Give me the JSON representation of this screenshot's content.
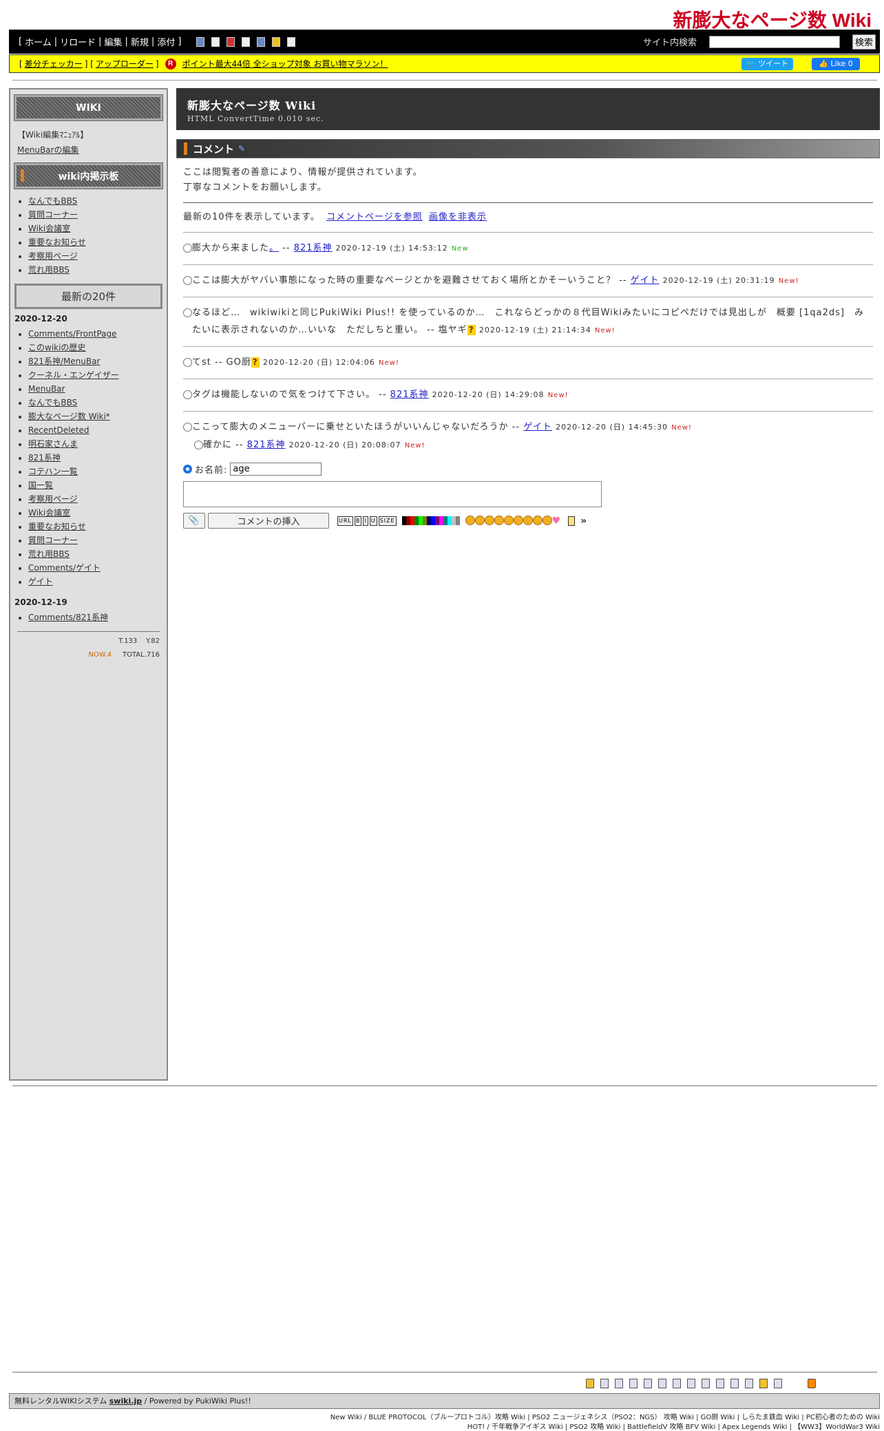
{
  "site_title": "新膨大なページ数 Wiki",
  "topnav": {
    "open_bracket": "[",
    "items": [
      "ホーム",
      "リロード",
      "編集",
      "新規",
      "添付"
    ],
    "separator": "|",
    "close_bracket": "]",
    "search_label": "サイト内検索",
    "search_button": "検索"
  },
  "yellowbar": {
    "diff_checker": "差分チェッカー",
    "uploader": "アップローダー",
    "promo": "ポイント最大44倍 全ショップ対象 お買い物マラソン！",
    "tweet": "ツイート",
    "like": "Like 0"
  },
  "sidebar": {
    "wiki_head": "WIKI",
    "manual_link": "【Wiki編集ﾏﾆｭｱﾙ】",
    "menubar_edit": "MenuBarの編集",
    "bbs_head": "wiki内掲示板",
    "bbs_items": [
      "なんでもBBS",
      "質問コーナー",
      "Wiki会議室",
      "重要なお知らせ",
      "考察用ページ",
      "荒れ用BBS"
    ],
    "recent_head": "最新の20件",
    "date1": "2020-12-20",
    "recent1": [
      "Comments/FrontPage",
      "このwikiの歴史",
      "821系神/MenuBar",
      "クーネル・エンゲイザー",
      "MenuBar",
      "なんでもBBS",
      "膨大なページ数 Wiki*",
      "RecentDeleted",
      "明石家さんま",
      "821系神",
      "コテハン一覧",
      "国一覧",
      "考察用ページ",
      "Wiki会議室",
      "重要なお知らせ",
      "質問コーナー",
      "荒れ用BBS",
      "Comments/ゲイト",
      "ゲイト"
    ],
    "date2": "2020-12-19",
    "recent2": [
      "Comments/821系神"
    ],
    "stat_t": "T.133",
    "stat_y": "Y.82",
    "stat_now": "NOW.4",
    "stat_total": "TOTAL.716"
  },
  "main": {
    "page_title": "新膨大なページ数 Wiki",
    "convert_time": "HTML ConvertTime 0.010 sec.",
    "section_title": "コメント",
    "intro1": "ここは閲覧者の善意により、情報が提供されています。",
    "intro2": "丁寧なコメントをお願いします。",
    "notice": "最新の10件を表示しています。",
    "see_comments": "コメントページを参照",
    "hide_images": "画像を非表示"
  },
  "comments": [
    {
      "text": "膨大から来ました",
      "mid_link": "。",
      "sep": " -- ",
      "author": "821系神",
      "date": "2020-12-19 (土) 14:53:12",
      "flag": "New"
    },
    {
      "text": "ここは膨大がヤバい事態になった時の重要なページとかを避難させておく場所とかそーいうこと？",
      "sep": " -- ",
      "author": "ゲイト",
      "date": "2020-12-19 (土) 20:31:19",
      "flag": "New!"
    },
    {
      "text": "なるほど…　wikiwikiと同じPukiWiki Plus!! を使っているのか…　これならどっかの８代目Wikiみたいにコピペだけでは見出しが　概要 [1qa2ds]　みたいに表示されないのか…いいな　ただしちと重い。",
      "sep": " -- ",
      "author": "塩ヤギ",
      "date": "2020-12-19 (土) 21:14:34",
      "flag": "New!"
    },
    {
      "text": "てst",
      "sep": " -- ",
      "author": "GO厨",
      "date": "2020-12-20 (日) 12:04:06",
      "flag": "New!"
    },
    {
      "text": "タグは機能しないので気をつけて下さい。",
      "sep": " -- ",
      "author": "821系神",
      "date": "2020-12-20 (日) 14:29:08",
      "flag": "New!"
    },
    {
      "text": "ここって膨大のメニューバーに乗せといたほうがいいんじゃないだろうか",
      "sep": " -- ",
      "author": "ゲイト",
      "date": "2020-12-20 (日) 14:45:30",
      "flag": "New!"
    },
    {
      "text": "確かに",
      "sep": " -- ",
      "author": "821系神",
      "date": "2020-12-20 (日) 20:08:07",
      "flag": "New!"
    }
  ],
  "form": {
    "name_label": "お名前:",
    "name_value": "age",
    "insert_button": "コメントの挿入",
    "fmt_buttons": [
      "URL",
      "B",
      "I",
      "U",
      "SIZE"
    ],
    "palette": [
      "#000000",
      "#800000",
      "#ff0000",
      "#008000",
      "#00ff00",
      "#808000",
      "#000080",
      "#0000ff",
      "#800080",
      "#ff00ff",
      "#008080",
      "#00ffff",
      "#c0c0c0",
      "#808080"
    ]
  },
  "footer": {
    "powered_prefix": "無料レンタルWIKIシステム",
    "powered_link": "swiki.jp",
    "powered_suffix": " /  Powered by PukiWiki Plus!!",
    "ext_line1": "New Wiki /  BLUE PROTOCOL（ブループロトコル）攻略 Wiki | PSO2 ニュージェネシス（PSO2：NGS） 攻略 Wiki | GO厨 Wiki | しらたま鉄血 Wiki | PC初心者のための Wiki",
    "ext_line2": "HOT! /  千年戦争アイギス Wiki  | PSO2 攻略 Wiki  | BattlefieldV 攻略 BFV Wiki  | Apex Legends Wiki  |  【WW3】WorldWar3 Wiki"
  }
}
